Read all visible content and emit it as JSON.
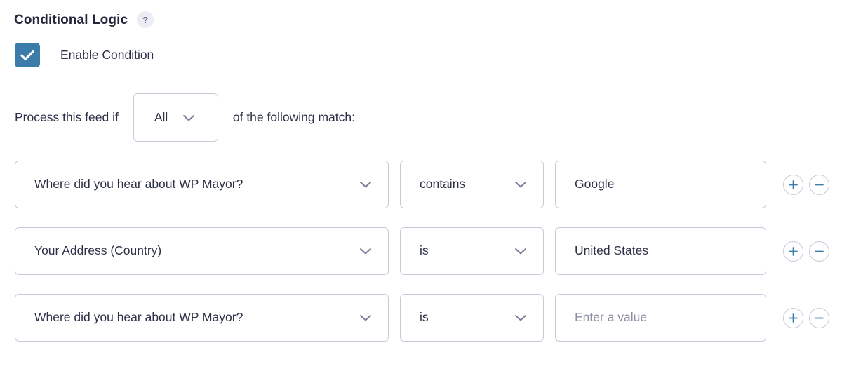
{
  "section": {
    "title": "Conditional Logic",
    "help_icon_label": "?",
    "help_icon_name": "question-mark-icon"
  },
  "enable_condition": {
    "label": "Enable Condition",
    "checked": true,
    "checkbox_color": "#3b7cab"
  },
  "process_rule": {
    "prefix_text": "Process this feed if",
    "match_type": "All",
    "suffix_text": "of the following match:"
  },
  "colors": {
    "border": "#c9cad8",
    "text": "#2c3048",
    "placeholder": "#8a8ca0",
    "accent": "#3b7cab",
    "help_badge_bg": "#ececf5",
    "chevron": "#7b7e99"
  },
  "row_actions": {
    "add_label": "+",
    "remove_label": "−"
  },
  "conditions": [
    {
      "field": "Where did you hear about WP Mayor?",
      "operator": "contains",
      "value": "Google",
      "value_is_placeholder": false
    },
    {
      "field": "Your Address (Country)",
      "operator": "is",
      "value": "United States",
      "value_is_placeholder": false
    },
    {
      "field": "Where did you hear about WP Mayor?",
      "operator": "is",
      "value": "Enter a value",
      "value_is_placeholder": true
    }
  ]
}
